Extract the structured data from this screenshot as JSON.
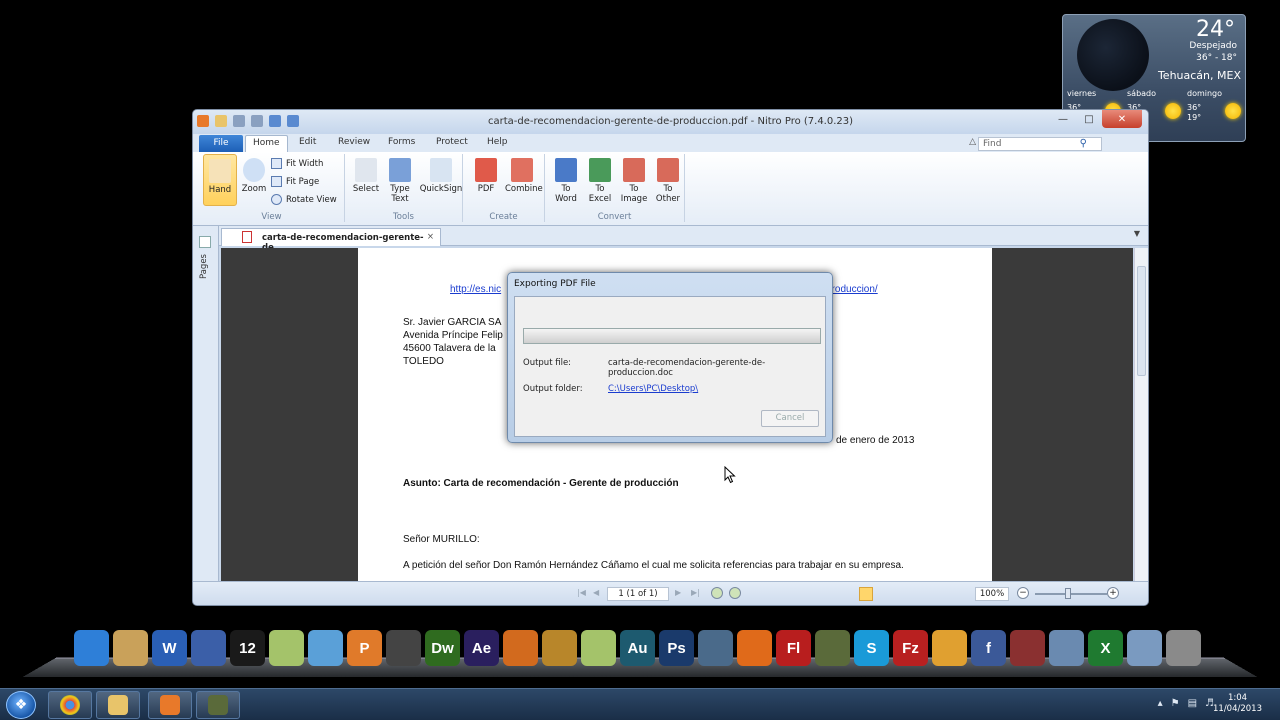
{
  "weather": {
    "temp": "24°",
    "condition": "Despejado",
    "range": "36° - 18°",
    "city": "Tehuacán, MEX",
    "days": [
      {
        "name": "viernes",
        "temp": "36°"
      },
      {
        "name": "sábado",
        "temp": "36°"
      },
      {
        "name": "domingo",
        "temp": "36°",
        "low": "19°"
      }
    ]
  },
  "window": {
    "title": "carta-de-recomendacion-gerente-de-produccion.pdf - Nitro Pro (7.4.0.23)",
    "tabs": [
      "File",
      "Home",
      "Edit",
      "Review",
      "Forms",
      "Protect",
      "Help"
    ],
    "active_tab": "Home",
    "find_placeholder": "Find"
  },
  "ribbon": {
    "view": {
      "label": "View",
      "hand": "Hand",
      "zoom": "Zoom",
      "fit_width": "Fit Width",
      "fit_page": "Fit Page",
      "rotate_view": "Rotate View"
    },
    "tools": {
      "label": "Tools",
      "select": "Select",
      "type_text_1": "Type",
      "type_text_2": "Text",
      "quicksign": "QuickSign"
    },
    "create": {
      "label": "Create",
      "pdf": "PDF",
      "combine": "Combine"
    },
    "convert": {
      "label": "Convert",
      "to_word_1": "To",
      "to_word_2": "Word",
      "to_excel_1": "To",
      "to_excel_2": "Excel",
      "to_image_1": "To",
      "to_image_2": "Image",
      "to_other_1": "To",
      "to_other_2": "Other"
    }
  },
  "doc_tab": {
    "name": "carta-de-recomendacion-gerente-de...",
    "close": "×"
  },
  "sidebar": {
    "pages_label": "Pages"
  },
  "document": {
    "link_start": "http://es.nic",
    "link_end": "produccion/",
    "address": [
      "Sr. Javier GARCIA SA",
      "Avenida Príncipe Felip",
      "45600 Talavera de la ",
      "TOLEDO"
    ],
    "date": "de enero de 2013",
    "subject": "Asunto: Carta de recomendación - Gerente de producción",
    "salutation": "Señor MURILLO:",
    "body": "A petición del señor Don Ramón Hernández Cáñamo el cual me solicita referencias para trabajar en su empresa."
  },
  "statusbar": {
    "page": "1 (1 of 1)",
    "zoom": "100%"
  },
  "dialog": {
    "title": "Exporting PDF File",
    "output_file_label": "Output file:",
    "output_file_value": "carta-de-recomendacion-gerente-de-produccion.doc",
    "output_folder_label": "Output folder:",
    "output_folder_value": "C:\\Users\\PC\\Desktop\\",
    "cancel": "Cancel"
  },
  "dock": {
    "icons": [
      {
        "name": "network-icon",
        "color": "#2e7fd8",
        "text": ""
      },
      {
        "name": "folder-icon",
        "color": "#c9a15a",
        "text": ""
      },
      {
        "name": "word-icon",
        "color": "#2a5fb5",
        "text": "W"
      },
      {
        "name": "itunes-icon",
        "color": "#3b5fa8",
        "text": ""
      },
      {
        "name": "nero-icon",
        "color": "#1a1a1a",
        "text": "12"
      },
      {
        "name": "notepad-icon",
        "color": "#a4c36a",
        "text": ""
      },
      {
        "name": "settings-icon",
        "color": "#5aa0d8",
        "text": ""
      },
      {
        "name": "powerpoint-icon",
        "color": "#e07a2a",
        "text": "P"
      },
      {
        "name": "winamp-icon",
        "color": "#444",
        "text": ""
      },
      {
        "name": "dreamweaver-icon",
        "color": "#2f6b1f",
        "text": "Dw"
      },
      {
        "name": "aftereffects-icon",
        "color": "#2a1f5e",
        "text": "Ae"
      },
      {
        "name": "paw-icon",
        "color": "#d26a1e",
        "text": ""
      },
      {
        "name": "lightning-icon",
        "color": "#b8862a",
        "text": ""
      },
      {
        "name": "notes-icon",
        "color": "#a4c36a",
        "text": ""
      },
      {
        "name": "audition-icon",
        "color": "#1d5a6f",
        "text": "Au"
      },
      {
        "name": "photoshop-icon",
        "color": "#1a3a6b",
        "text": "Ps"
      },
      {
        "name": "monitor-icon",
        "color": "#4a6a8a",
        "text": ""
      },
      {
        "name": "firefox-icon",
        "color": "#e06a1a",
        "text": ""
      },
      {
        "name": "flash-icon",
        "color": "#b81e1e",
        "text": "Fl"
      },
      {
        "name": "halo-icon",
        "color": "#5a6a3a",
        "text": ""
      },
      {
        "name": "skype-icon",
        "color": "#1a9ad8",
        "text": "S"
      },
      {
        "name": "filezilla-icon",
        "color": "#b82020",
        "text": "Fz"
      },
      {
        "name": "mail-icon",
        "color": "#e0a030",
        "text": ""
      },
      {
        "name": "facebook-icon",
        "color": "#3b5998",
        "text": "f"
      },
      {
        "name": "game-icon",
        "color": "#8a3030",
        "text": ""
      },
      {
        "name": "tools-icon",
        "color": "#6a8ab0",
        "text": ""
      },
      {
        "name": "excel-icon",
        "color": "#1f7a30",
        "text": "X"
      },
      {
        "name": "laptop-icon",
        "color": "#7a9ac0",
        "text": ""
      },
      {
        "name": "trash-icon",
        "color": "#8a8a8a",
        "text": ""
      }
    ]
  },
  "taskbar": {
    "clock_time": "1:04",
    "clock_date": "11/04/2013"
  }
}
